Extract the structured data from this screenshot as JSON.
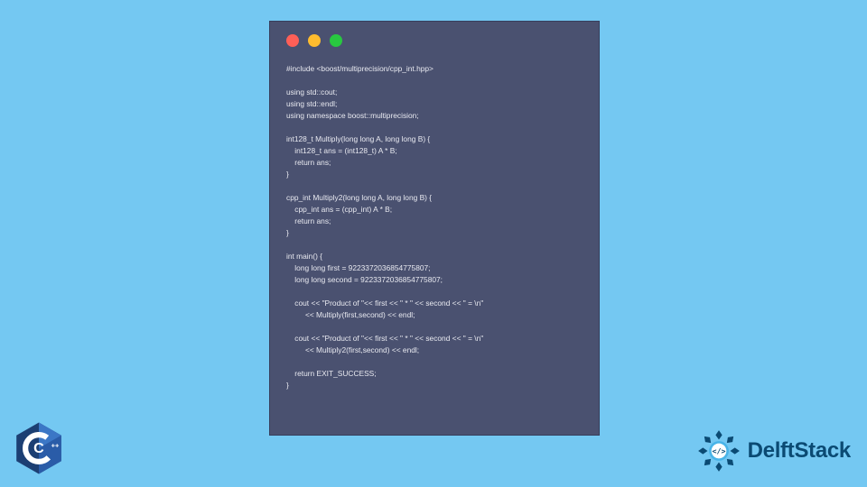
{
  "code": {
    "lines": [
      "#include <boost/multiprecision/cpp_int.hpp>",
      "",
      "using std::cout;",
      "using std::endl;",
      "using namespace boost::multiprecision;",
      "",
      "int128_t Multiply(long long A, long long B) {",
      "    int128_t ans = (int128_t) A * B;",
      "    return ans;",
      "}",
      "",
      "cpp_int Multiply2(long long A, long long B) {",
      "    cpp_int ans = (cpp_int) A * B;",
      "    return ans;",
      "}",
      "",
      "int main() {",
      "    long long first = 9223372036854775807;",
      "    long long second = 9223372036854775807;",
      "",
      "    cout << \"Product of \"<< first << \" * \" << second << \" = \\n\"",
      "         << Multiply(first,second) << endl;",
      "",
      "    cout << \"Product of \"<< first << \" * \" << second << \" = \\n\"",
      "         << Multiply2(first,second) << endl;",
      "",
      "    return EXIT_SUCCESS;",
      "}"
    ]
  },
  "cpp_badge": {
    "label": "C++"
  },
  "brand": {
    "name": "DelftStack"
  },
  "colors": {
    "background": "#74c8f2",
    "window": "#4a5170",
    "brand_blue": "#0b4a73"
  }
}
